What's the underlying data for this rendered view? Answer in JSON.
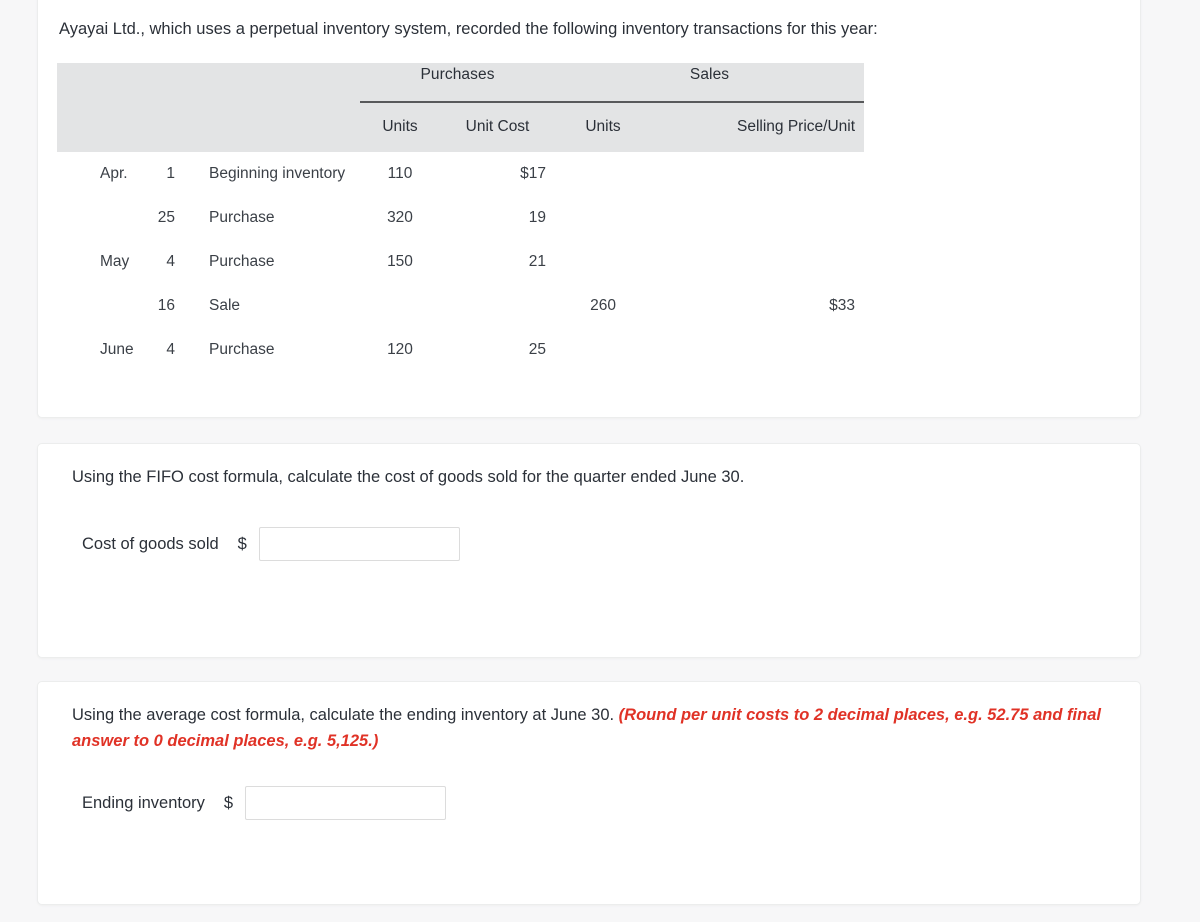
{
  "intro": {
    "text": "Ayayai Ltd., which uses a perpetual inventory system, recorded the following inventory transactions for this year:"
  },
  "table": {
    "group_headers": {
      "purchases": "Purchases",
      "sales": "Sales"
    },
    "column_headers": {
      "purchases_units": "Units",
      "purchases_unit_cost": "Unit Cost",
      "sales_units": "Units",
      "sales_selling_price": "Selling Price/Unit"
    },
    "rows": [
      {
        "month": "Apr.",
        "day": "1",
        "description": "Beginning inventory",
        "purchase_units": "110",
        "purchase_unit_cost": "$17",
        "sales_units": "",
        "selling_price": ""
      },
      {
        "month": "",
        "day": "25",
        "description": "Purchase",
        "purchase_units": "320",
        "purchase_unit_cost": "19",
        "sales_units": "",
        "selling_price": ""
      },
      {
        "month": "May",
        "day": "4",
        "description": "Purchase",
        "purchase_units": "150",
        "purchase_unit_cost": "21",
        "sales_units": "",
        "selling_price": ""
      },
      {
        "month": "",
        "day": "16",
        "description": "Sale",
        "purchase_units": "",
        "purchase_unit_cost": "",
        "sales_units": "260",
        "selling_price": "$33"
      },
      {
        "month": "June",
        "day": "4",
        "description": "Purchase",
        "purchase_units": "120",
        "purchase_unit_cost": "25",
        "sales_units": "",
        "selling_price": ""
      }
    ]
  },
  "fifo": {
    "question": "Using the FIFO cost formula, calculate the cost of goods sold for the quarter ended June 30.",
    "answer_label": "Cost of goods sold",
    "currency_symbol": "$",
    "answer_value": "",
    "answer_placeholder": ""
  },
  "average": {
    "question_main": "Using the average cost formula, calculate the ending inventory at June 30.",
    "question_hint": "(Round per unit costs to 2 decimal places, e.g. 52.75 and final answer to 0 decimal places, e.g. 5,125.)",
    "answer_label": "Ending inventory",
    "currency_symbol": "$",
    "answer_value": "",
    "answer_placeholder": ""
  },
  "colors": {
    "hint_red": "#e03226",
    "header_gray": "#e3e4e5",
    "text": "#2b3038",
    "page_bg": "#f7f7f8"
  }
}
